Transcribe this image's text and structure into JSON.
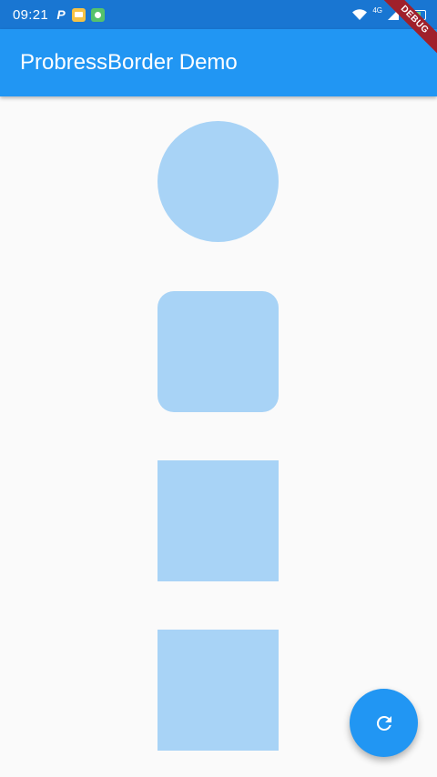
{
  "status_bar": {
    "time": "09:21",
    "notification_icons": [
      "p-icon",
      "message-icon",
      "app-icon"
    ],
    "network_label": "4G"
  },
  "app_bar": {
    "title": "ProbressBorder Demo"
  },
  "debug_banner": {
    "label": "DEBUG"
  },
  "shapes": [
    {
      "kind": "circle"
    },
    {
      "kind": "rounded-rectangle"
    },
    {
      "kind": "square"
    },
    {
      "kind": "square"
    }
  ],
  "fab": {
    "icon": "refresh-icon"
  },
  "colors": {
    "status_bar": "#1976d2",
    "app_bar": "#2196f3",
    "shape_fill": "#a8d3f6",
    "fab": "#2196f3",
    "background": "#fafafa"
  }
}
